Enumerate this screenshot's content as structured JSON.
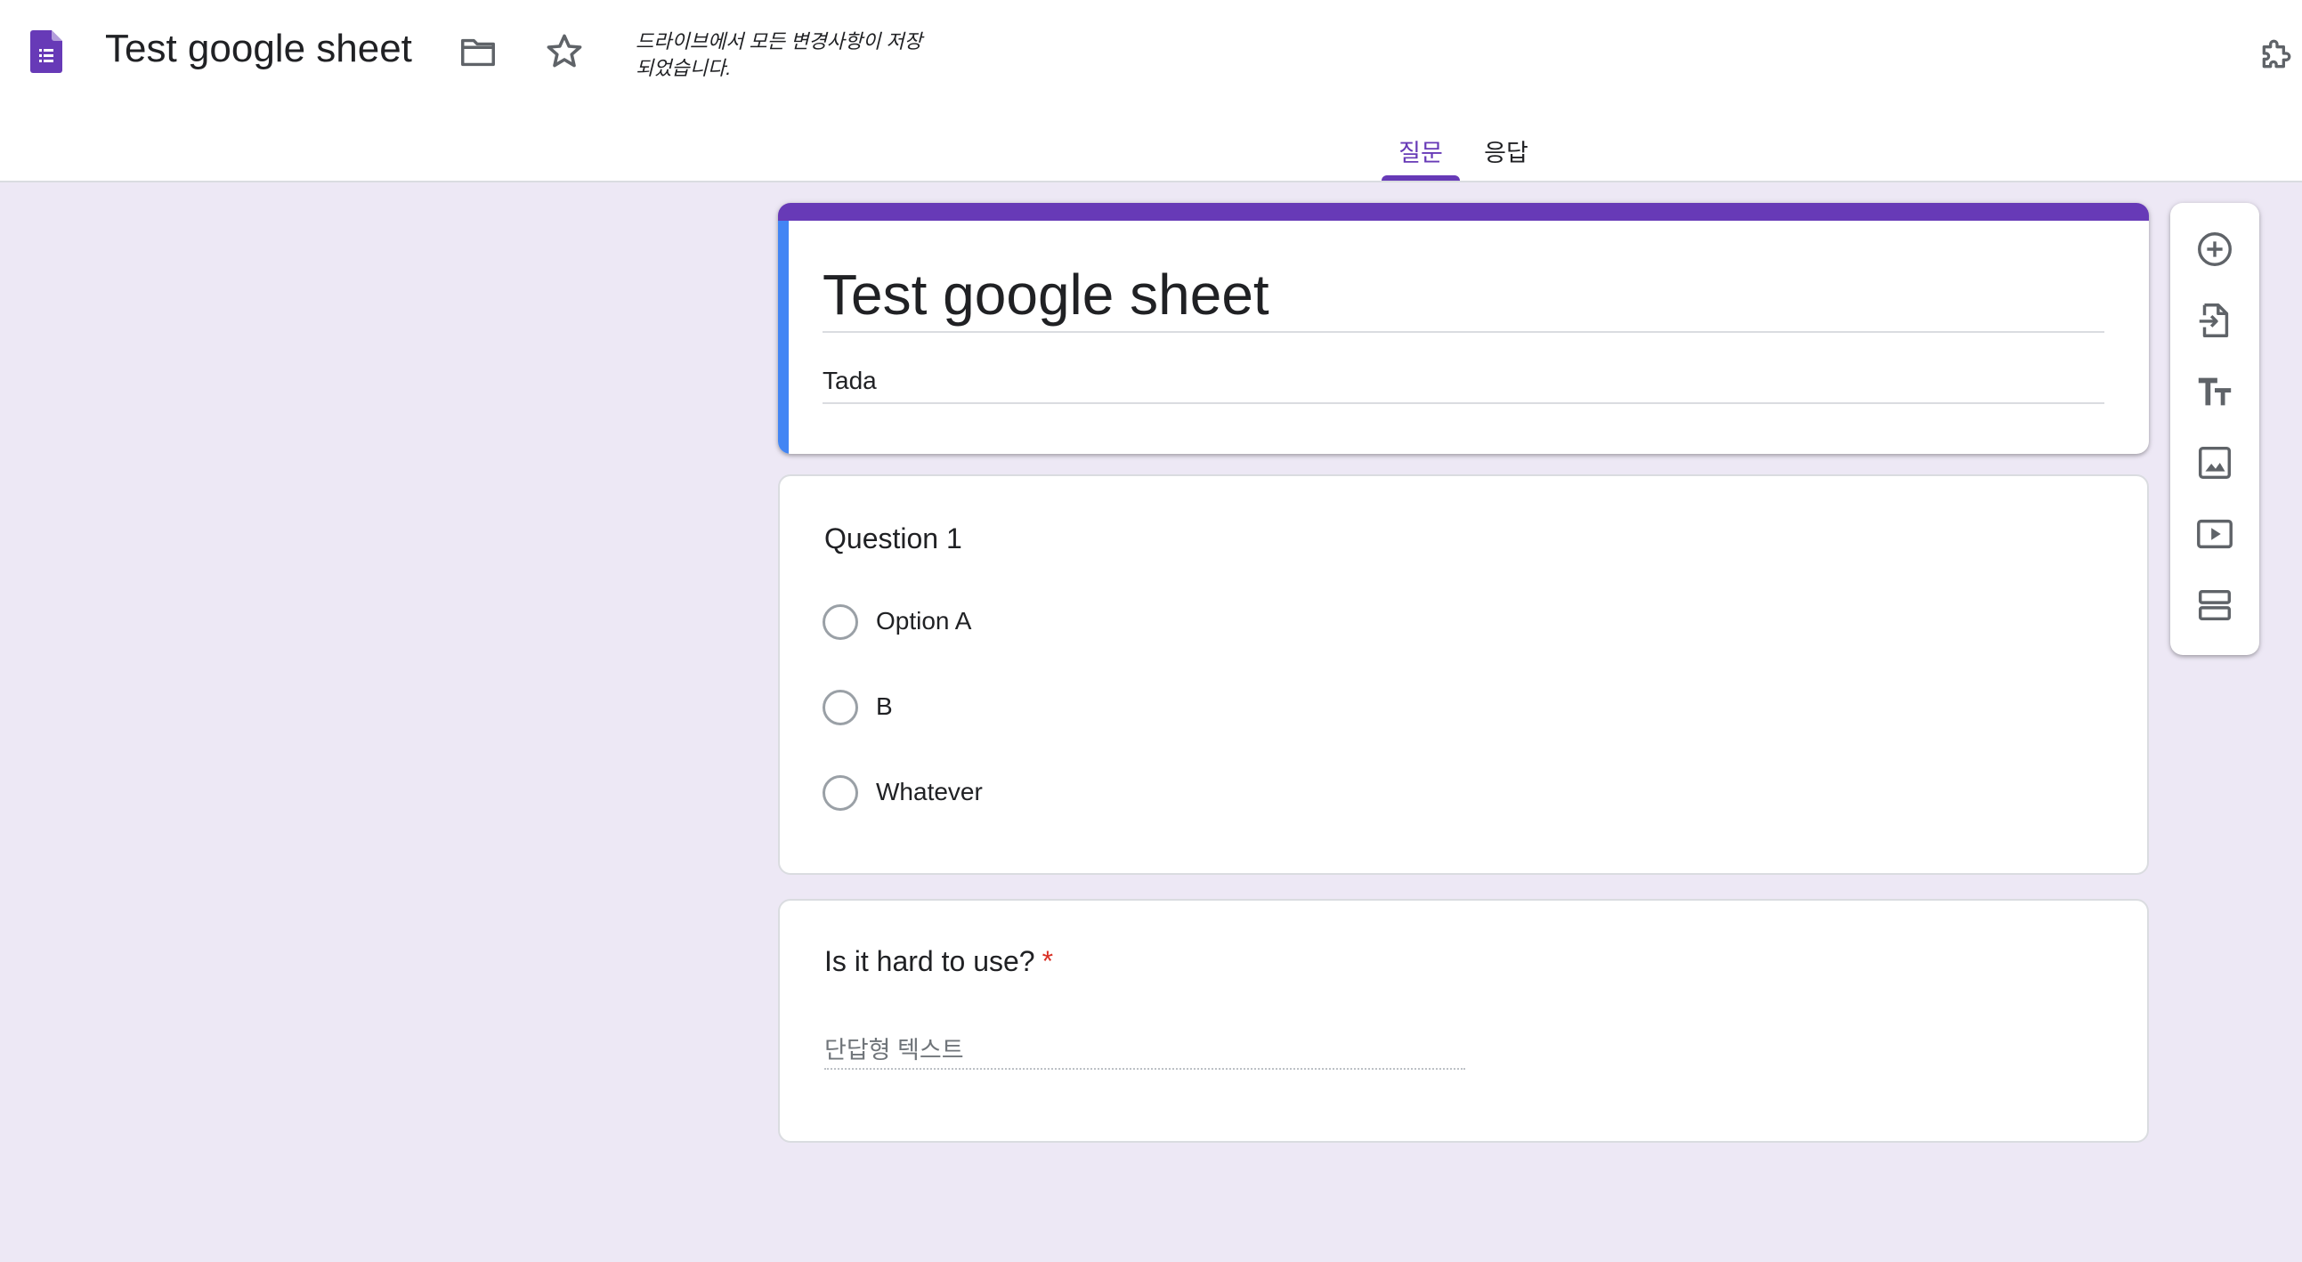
{
  "header": {
    "app_icon": "google-forms-icon",
    "document_title": "Test google sheet",
    "folder_icon": "folder-icon",
    "star_icon": "star-icon",
    "save_status": "드라이브에서 모든 변경사항이 저장되었습니다.",
    "addon_icon": "puzzle-piece-icon"
  },
  "tabs": {
    "questions": "질문",
    "responses": "응답",
    "active": "questions"
  },
  "form": {
    "title": "Test google sheet",
    "description": "Tada"
  },
  "questions": [
    {
      "title": "Question 1",
      "type": "multiple-choice",
      "options": [
        "Option A",
        "B",
        "Whatever"
      ]
    },
    {
      "title": "Is it hard to use?",
      "required_mark": "*",
      "type": "short-answer",
      "placeholder": "단답형 텍스트"
    }
  ],
  "toolbar": {
    "tools": [
      "add-question-icon",
      "import-questions-icon",
      "add-title-icon",
      "add-image-icon",
      "add-video-icon",
      "add-section-icon"
    ]
  },
  "colors": {
    "accent": "#673ab7",
    "focus_bar": "#4285f4",
    "background": "#ede8f5",
    "required": "#d93025"
  }
}
